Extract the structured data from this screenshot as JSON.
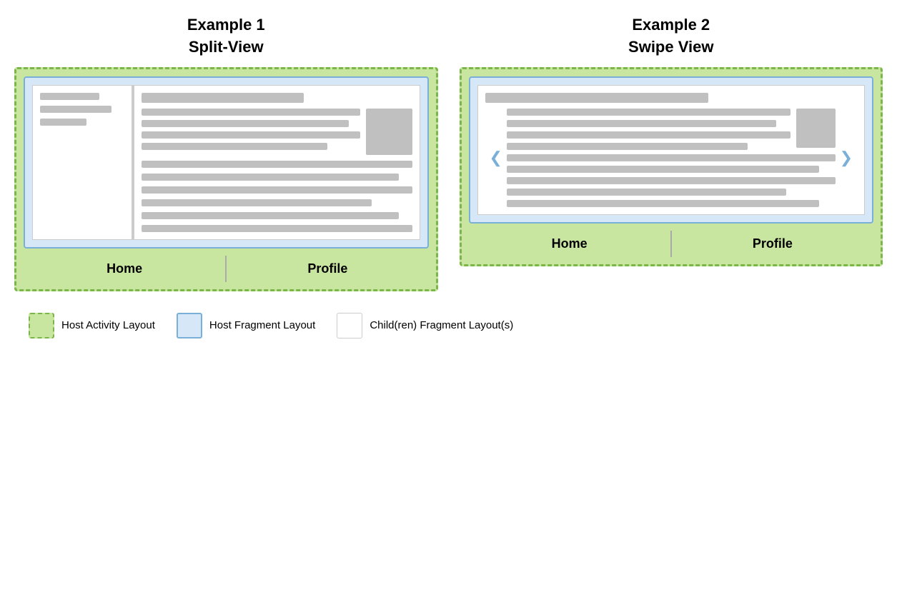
{
  "example1": {
    "title_line1": "Example 1",
    "title_line2": "Split-View",
    "nav": {
      "home": "Home",
      "profile": "Profile"
    }
  },
  "example2": {
    "title_line1": "Example 2",
    "title_line2": "Swipe View",
    "nav": {
      "home": "Home",
      "profile": "Profile"
    },
    "arrow_left": "❮",
    "arrow_right": "❯"
  },
  "legend": {
    "items": [
      {
        "id": "host-activity",
        "label": "Host Activity Layout"
      },
      {
        "id": "host-fragment",
        "label": "Host Fragment Layout"
      },
      {
        "id": "children-fragment",
        "label": "Child(ren) Fragment Layout(s)"
      }
    ]
  }
}
